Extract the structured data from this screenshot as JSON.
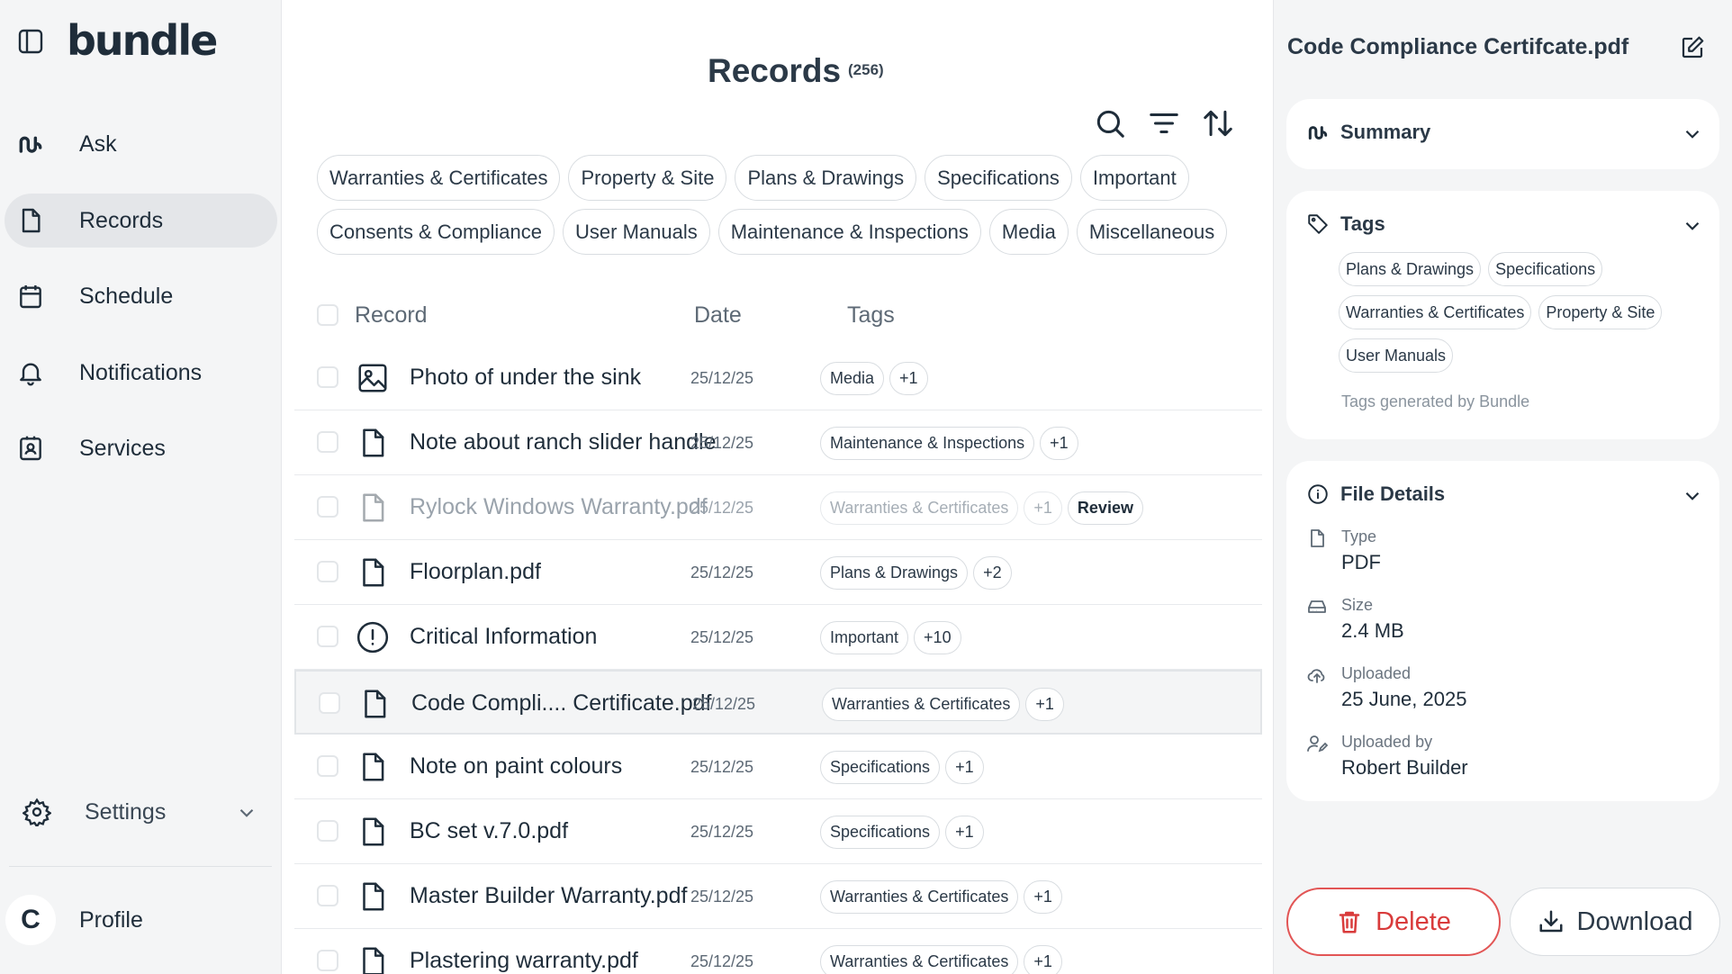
{
  "app": {
    "logo": "bundle"
  },
  "sidebar": {
    "items": [
      {
        "label": "Ask",
        "icon": "bundle-logo-icon"
      },
      {
        "label": "Records",
        "icon": "document-icon",
        "active": true
      },
      {
        "label": "Schedule",
        "icon": "calendar-icon"
      },
      {
        "label": "Notifications",
        "icon": "bell-icon"
      },
      {
        "label": "Services",
        "icon": "badge-icon"
      }
    ],
    "settings_label": "Settings",
    "profile_initial": "C",
    "profile_label": "Profile"
  },
  "main": {
    "title": "Records",
    "count": "(256)",
    "filter_chips_row1": [
      "Warranties & Certificates",
      "Property & Site",
      "Plans & Drawings",
      "Specifications",
      "Important"
    ],
    "filter_chips_row2": [
      "Consents & Compliance",
      "User Manuals",
      "Maintenance & Inspections",
      "Media",
      "Miscellaneous"
    ],
    "columns": {
      "record": "Record",
      "date": "Date",
      "tags": "Tags"
    },
    "rows": [
      {
        "name": "Photo of under the sink",
        "icon": "image-icon",
        "date": "25/12/25",
        "tag": "Media",
        "more": "+1"
      },
      {
        "name": "Note about ranch slider handle",
        "icon": "document-icon",
        "date": "25/12/25",
        "tag": "Maintenance & Inspections",
        "more": "+1"
      },
      {
        "name": "Rylock Windows Warranty.pdf",
        "icon": "document-icon",
        "date": "25/12/25",
        "tag": "Warranties & Certificates",
        "more": "+1",
        "badge": "Review",
        "dimmed": true
      },
      {
        "name": "Floorplan.pdf",
        "icon": "document-icon",
        "date": "25/12/25",
        "tag": "Plans & Drawings",
        "more": "+2"
      },
      {
        "name": "Critical Information",
        "icon": "alert-circle-icon",
        "date": "25/12/25",
        "tag": "Important",
        "more": "+10"
      },
      {
        "name": "Code Compli.... Certificate.pdf",
        "icon": "document-icon",
        "date": "25/12/25",
        "tag": "Warranties & Certificates",
        "more": "+1",
        "selected": true
      },
      {
        "name": "Note on paint colours",
        "icon": "document-icon",
        "date": "25/12/25",
        "tag": "Specifications",
        "more": "+1"
      },
      {
        "name": "BC set v.7.0.pdf",
        "icon": "document-icon",
        "date": "25/12/25",
        "tag": "Specifications",
        "more": "+1"
      },
      {
        "name": "Master Builder Warranty.pdf",
        "icon": "document-icon",
        "date": "25/12/25",
        "tag": "Warranties & Certificates",
        "more": "+1"
      },
      {
        "name": "Plastering warranty.pdf",
        "icon": "document-icon",
        "date": "25/12/25",
        "tag": "Warranties & Certificates",
        "more": "+1"
      }
    ]
  },
  "panel": {
    "title": "Code Compliance Certifcate.pdf",
    "summary_label": "Summary",
    "tags_label": "Tags",
    "tags_row1": [
      "Plans & Drawings",
      "Specifications"
    ],
    "tags_row2": [
      "Warranties & Certificates",
      "Property & Site"
    ],
    "tags_row3": [
      "User Manuals"
    ],
    "tags_note": "Tags generated by Bundle",
    "file_details_label": "File Details",
    "type_label": "Type",
    "type_value": "PDF",
    "size_label": "Size",
    "size_value": "2.4 MB",
    "uploaded_label": "Uploaded",
    "uploaded_value": "25 June, 2025",
    "uploaded_by_label": "Uploaded by",
    "uploaded_by_value": "Robert Builder",
    "delete_label": "Delete",
    "download_label": "Download"
  },
  "colors": {
    "danger": "#d93b3b",
    "text": "#1f2d3a",
    "sidebar_bg": "#f4f5f6"
  }
}
